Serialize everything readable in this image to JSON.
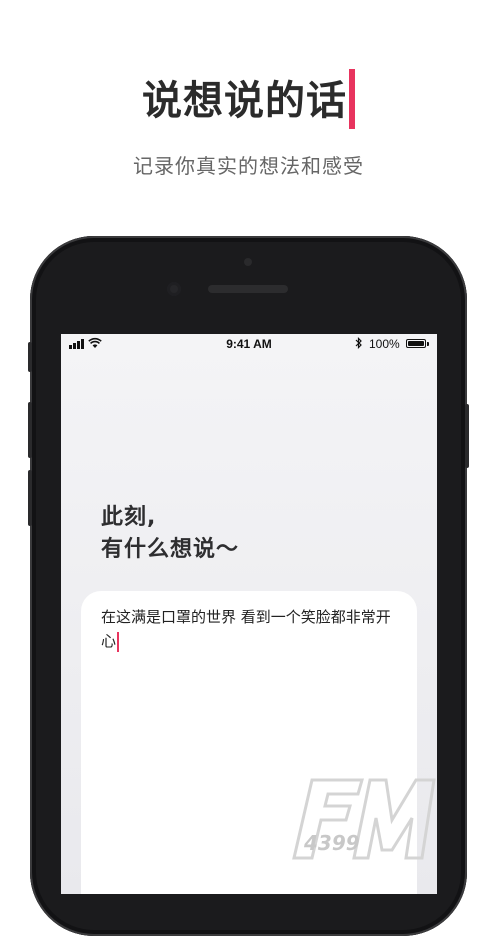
{
  "promo": {
    "headline": "说想说的话",
    "subheadline": "记录你真实的想法和感受",
    "accent_color": "#e8345e"
  },
  "status_bar": {
    "time": "9:41 AM",
    "battery": "100%",
    "signal_icon": "signal-bars-icon",
    "wifi_icon": "wifi-icon",
    "bluetooth_icon": "bluetooth-icon",
    "battery_icon": "battery-icon"
  },
  "app": {
    "prompt_line1": "此刻,",
    "prompt_line2": "有什么想说～",
    "entry_text": "在这满是口罩的世界 看到一个笑脸都非常开心"
  },
  "watermark": {
    "brand": "FM",
    "number": "4399"
  }
}
